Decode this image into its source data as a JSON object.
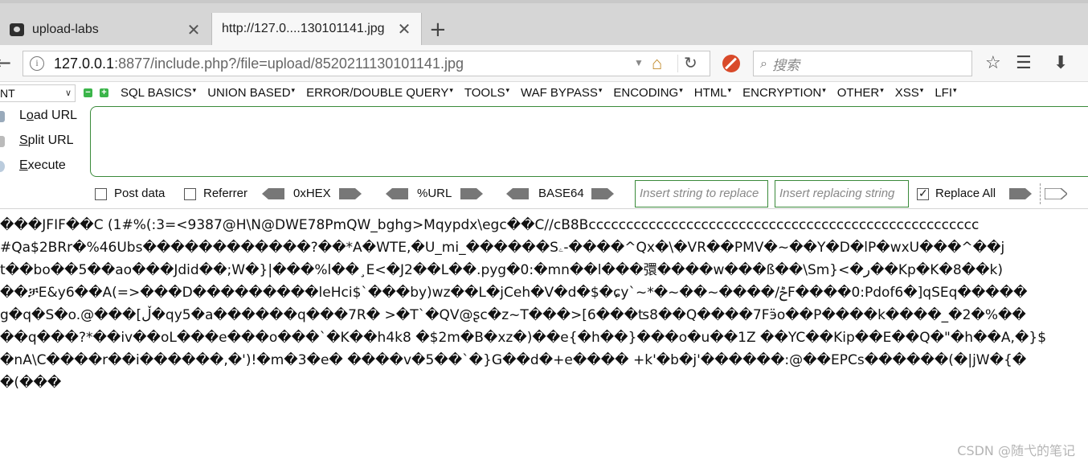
{
  "tabs": [
    {
      "label": "upload-labs",
      "close": "✕"
    },
    {
      "label": "http://127.0....130101141.jpg",
      "close": "✕"
    }
  ],
  "new_tab_icon": "+",
  "nav": {
    "url_host": "127.0.0.1",
    "url_path": ":8877/include.php?/file=upload/8520211130101141.jpg",
    "search_placeholder": "搜索",
    "icons": [
      "back-arrow-icon",
      "info-icon",
      "dropdown-icon",
      "home-icon",
      "reload-icon",
      "blocked-icon",
      "search-icon",
      "star-icon",
      "library-icon",
      "download-icon"
    ]
  },
  "hackbar": {
    "select_value": "NT",
    "menus": [
      "SQL BASICS",
      "UNION BASED",
      "ERROR/DOUBLE QUERY",
      "TOOLS",
      "WAF BYPASS",
      "ENCODING",
      "HTML",
      "ENCRYPTION",
      "OTHER",
      "XSS",
      "LFI"
    ],
    "actions": {
      "load": "Load URL",
      "split": "Split URL",
      "execute": "Execute"
    },
    "options": {
      "post_data": "Post data",
      "referrer": "Referrer",
      "hex": "0xHEX",
      "url": "%URL",
      "base64": "BASE64",
      "replace_placeholder": "Insert string to replace",
      "replacing_placeholder": "Insert replacing string",
      "replace_all": "Replace All"
    },
    "replace_all_checked": true,
    "accent_color": "#3a8a3a"
  },
  "content": {
    "lines": [
      "���JFIF��C  (1#%(:3=<9387@H\\N@DWE78PmQW_bghg>Mqypdx\\egc��C//cB8Bcccccccccccccccccccccccccccccccccccccccccccccccccccc",
      "#Qa$2BRr�%46Ubs������������?��*A�WTE,�U_mi_������Sۦ-����^Qx�\\�VR��PMV�~��Y�D�lP�wxU���^��j",
      "t��bo��5��ao���Jdid��;W�}|���%l��¸E<�J2��L��.pyg�0:�mn��l���彋����w���ß��\\Sm}<�ر��Kp�K�8��k)",
      "��ቻE&y6��A(=>���D���������leHci$`���by)wz��L�jCeh�V�d�$�ɕy`~*�~��~����/ݲF����0:Pdof6�]qSEq�����",
      "g�q�S�o.@���[ڵ�qy5�a������q���7R� >�T`�QV@ʂc�z~T���>[6���ʦ8��Q����7Fӭo��P����k����_�2�%��",
      "��q���?*��iv��oL���e���o���`�K��h4k8 �$2m�B�xz�)��e{�h��}���o�u��1Z ��YC��Kip��E��Q�\"�h��A,�}$",
      "�nA\\C����r��i������,�')!�m�3�e� ����v�5��`�}G��d�+e���� +k'�b�j'������:@��EPCs������(�|jW�{�",
      "�(���"
    ]
  },
  "watermark": "CSDN @随弋的笔记"
}
